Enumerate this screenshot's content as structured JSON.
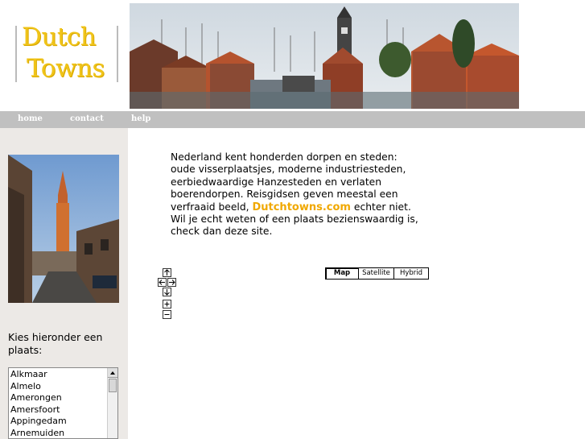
{
  "logo": {
    "line1": "Dutch",
    "line2": "Towns"
  },
  "nav": {
    "items": [
      "home",
      "contact",
      "help"
    ]
  },
  "intro": {
    "before": "Nederland kent honderden dorpen en steden: oude visserplaatsjes, moderne industriesteden, eerbiedwaardige Hanzesteden en verlaten boerendorpen. Reisgidsen geven meestal een verfraaid beeld, ",
    "brand": "Dutchtowns.com",
    "after": " echter niet. Wil je echt weten of een plaats bezienswaardig is, check dan deze site."
  },
  "sidebar": {
    "choose_label": " Kies hieronder een plaats:",
    "cities": [
      "Alkmaar",
      "Almelo",
      "Amerongen",
      "Amersfoort",
      "Appingedam",
      "Arnemuiden"
    ]
  },
  "map": {
    "type_buttons": [
      "Map",
      "Satellite",
      "Hybrid"
    ],
    "selected_type": "Map",
    "controls": [
      "pan-up-icon",
      "pan-left-icon",
      "pan-right-icon",
      "pan-down-icon",
      "zoom-in-icon",
      "zoom-out-icon"
    ]
  },
  "colors": {
    "logo": "#f0c419",
    "brand_link": "#f0a800",
    "navbar": "#c0c0c0",
    "sidebar": "#ece9e6"
  }
}
